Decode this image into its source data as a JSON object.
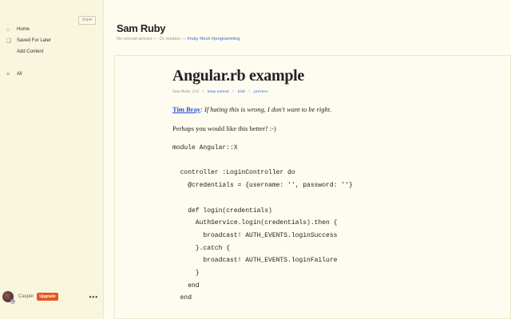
{
  "sidebar": {
    "unpin_label": "Unpin",
    "items": [
      {
        "label": "Home",
        "icon": "home-icon"
      },
      {
        "label": "Saved For Later",
        "icon": "bookmark-icon"
      },
      {
        "label": "Add Content",
        "icon": ""
      }
    ],
    "all_label": "All",
    "user": {
      "name": "Casper",
      "upgrade_label": "Upgrade",
      "more_label": "•••"
    }
  },
  "feed": {
    "title": "Sam Ruby",
    "meta_prefix": "No unread articles — 1K readers — ",
    "tags": "#ruby #tech #programming"
  },
  "article": {
    "title": "Angular.rb example",
    "byline": "Sam Ruby 21d",
    "actions": [
      "keep unread",
      "hide",
      "preview"
    ],
    "author_link": "Tim Bray",
    "quote": ": If hating this is wrong, I don't want to be right.",
    "paragraph": "Perhaps you would like this better?  :-)",
    "code": "module Angular::X\n\n  controller :LoginController do\n    @credentials = {username: '', password: ''}\n\n    def login(credentials)\n      AuthService.login(credentials).then {\n        broadcast! AUTH_EVENTS.loginSuccess\n      }.catch {\n        broadcast! AUTH_EVENTS.loginFailure\n      }\n    end\n  end"
  }
}
